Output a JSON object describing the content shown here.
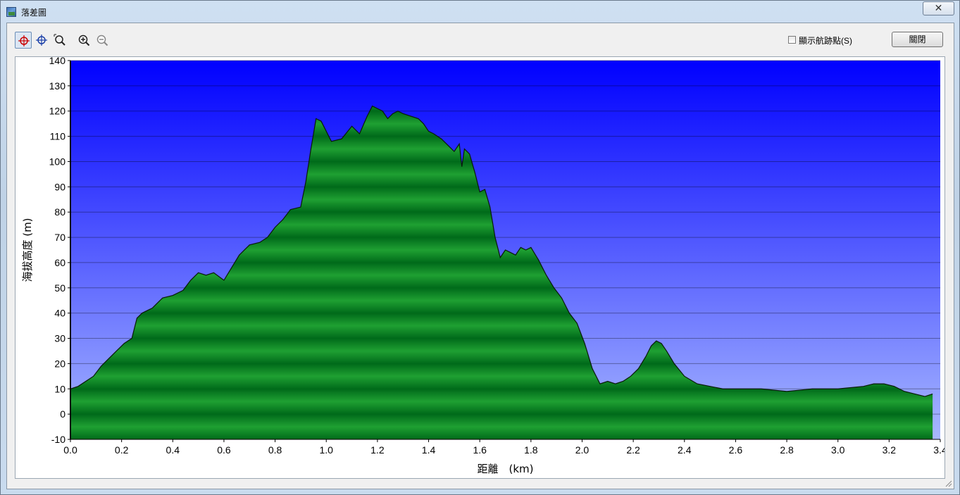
{
  "window": {
    "title": "落差圖",
    "close_glyph": "✕"
  },
  "toolbar": {
    "tools": [
      {
        "name": "crosshair-select-icon",
        "active": true
      },
      {
        "name": "crosshair-icon",
        "active": false
      },
      {
        "name": "zoom-region-icon",
        "active": false
      },
      {
        "name": "zoom-in-icon",
        "active": false
      },
      {
        "name": "zoom-out-icon",
        "active": false
      }
    ],
    "show_waypoints_label": "顯示航跡點(S)",
    "show_waypoints_checked": false,
    "close_button_label": "關閉"
  },
  "colors": {
    "plot_top": "#0000ff",
    "plot_bottom": "#a8b8ff",
    "fill_dark": "#006a1a",
    "fill_light": "#1fa032",
    "outline": "#0a1a0a"
  },
  "chart_data": {
    "type": "area",
    "title": "",
    "xlabel": "距離　(km)",
    "ylabel": "海拔高度 (m)",
    "xlim": [
      0.0,
      3.4
    ],
    "ylim": [
      -10,
      140
    ],
    "x_ticks": [
      "0.0",
      "0.2",
      "0.4",
      "0.6",
      "0.8",
      "1.0",
      "1.2",
      "1.4",
      "1.6",
      "1.8",
      "2.0",
      "2.2",
      "2.4",
      "2.6",
      "2.8",
      "3.0",
      "3.2",
      "3.4"
    ],
    "y_ticks": [
      "-10",
      "0",
      "10",
      "20",
      "30",
      "40",
      "50",
      "60",
      "70",
      "80",
      "90",
      "100",
      "110",
      "120",
      "130",
      "140"
    ],
    "grid": true,
    "series": [
      {
        "x": [
          0.0,
          0.03,
          0.06,
          0.09,
          0.12,
          0.15,
          0.18,
          0.21,
          0.24,
          0.26,
          0.28,
          0.3,
          0.32,
          0.34,
          0.36,
          0.4,
          0.44,
          0.47,
          0.5,
          0.53,
          0.56,
          0.6,
          0.63,
          0.66,
          0.7,
          0.74,
          0.77,
          0.8,
          0.83,
          0.86,
          0.9,
          0.92,
          0.94,
          0.96,
          0.98,
          1.02,
          1.06,
          1.1,
          1.13,
          1.16,
          1.18,
          1.2,
          1.22,
          1.24,
          1.26,
          1.28,
          1.3,
          1.33,
          1.36,
          1.38,
          1.4,
          1.42,
          1.45,
          1.48,
          1.5,
          1.52,
          1.53,
          1.54,
          1.56,
          1.58,
          1.6,
          1.62,
          1.64,
          1.66,
          1.68,
          1.7,
          1.72,
          1.74,
          1.76,
          1.78,
          1.8,
          1.83,
          1.86,
          1.89,
          1.92,
          1.95,
          1.98,
          2.01,
          2.04,
          2.07,
          2.1,
          2.13,
          2.16,
          2.19,
          2.22,
          2.25,
          2.27,
          2.29,
          2.31,
          2.33,
          2.36,
          2.4,
          2.45,
          2.5,
          2.55,
          2.6,
          2.7,
          2.8,
          2.9,
          3.0,
          3.1,
          3.14,
          3.18,
          3.22,
          3.26,
          3.3,
          3.34,
          3.37
        ],
        "values": [
          10,
          11,
          13,
          15,
          19,
          22,
          25,
          28,
          30,
          38,
          40,
          41,
          42,
          44,
          46,
          47,
          49,
          53,
          56,
          55,
          56,
          53,
          58,
          63,
          67,
          68,
          70,
          74,
          77,
          81,
          82,
          92,
          105,
          117,
          116,
          108,
          109,
          114,
          111,
          118,
          122,
          121,
          120,
          117,
          119,
          120,
          119,
          118,
          117,
          115,
          112,
          111,
          109,
          106,
          104,
          107,
          98,
          105,
          103,
          96,
          88,
          89,
          82,
          70,
          62,
          65,
          64,
          63,
          66,
          65,
          66,
          61,
          55,
          50,
          46,
          40,
          36,
          28,
          18,
          12,
          13,
          12,
          13,
          15,
          18,
          23,
          27,
          29,
          28,
          25,
          20,
          15,
          12,
          11,
          10,
          10,
          10,
          9,
          10,
          10,
          11,
          12,
          12,
          11,
          9,
          8,
          7,
          8
        ]
      }
    ]
  }
}
